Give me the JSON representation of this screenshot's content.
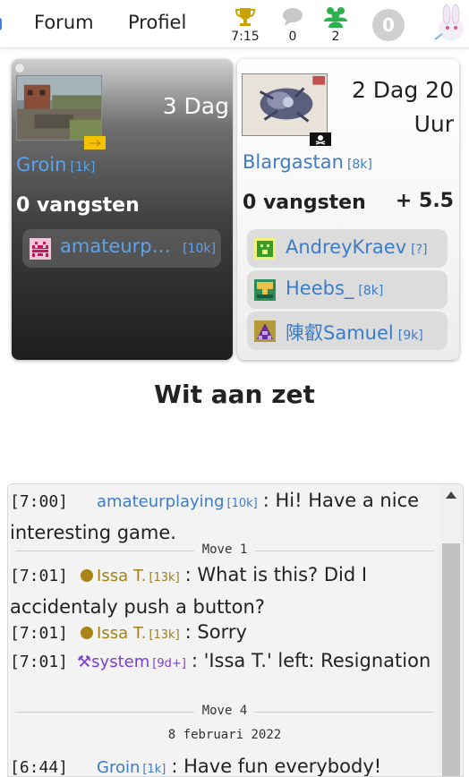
{
  "nav": {
    "forum_label": "Forum",
    "profile_label": "Profiel",
    "clock_value": "7:15",
    "chat_count": "0",
    "friends_count": "2",
    "notification_count": "0",
    "icons": [
      "trophy-icon",
      "chat-bubble-icon",
      "friends-icon",
      "notification-badge",
      "avatar"
    ],
    "colors": {
      "trophy": "#c9a400",
      "chat": "#c8c8c8",
      "friends": "#2bb24c"
    }
  },
  "black_player": {
    "clock": "3 Dag",
    "name": "Groin",
    "rank": "[1k]",
    "captures": "0 vangsten",
    "observer": {
      "name": "amateurplaying",
      "name_display": "amateurpl…",
      "rank": "[10k]"
    }
  },
  "white_player": {
    "clock": "2 Dag 20 Uur",
    "name": "Blargastan",
    "rank": "[8k]",
    "captures": "0 vangsten",
    "komi": "+ 5.5",
    "observers": [
      {
        "name": "AndreyKraev",
        "rank": "[?]"
      },
      {
        "name": "Heebs_",
        "rank": "[8k]"
      },
      {
        "name": "陳叡Samuel",
        "rank": "[9k]"
      }
    ]
  },
  "turn_label": "Wit aan zet",
  "chat": {
    "messages": [
      {
        "time": "[7:00]",
        "user": "amateurplaying",
        "rank": "[10k]",
        "text": ": Hi! Have a nice interesting game."
      },
      {
        "time": "[7:01]",
        "user": "Issa T.",
        "rank": "[13k]",
        "text": ": What is this? Did I accidentaly push a button?"
      },
      {
        "time": "[7:01]",
        "user": "Issa T.",
        "rank": "[13k]",
        "text": ": Sorry"
      },
      {
        "time": "[7:01]",
        "user": "system",
        "rank": "[9d+]",
        "text": ": 'Issa T.' left: Resignation"
      },
      {
        "time": "[6:44]",
        "user": "Groin",
        "rank": "[1k]",
        "text": ": Have fun everybody!"
      }
    ],
    "separators": [
      "Move 1",
      "Move 4",
      "8 februari 2022"
    ]
  }
}
